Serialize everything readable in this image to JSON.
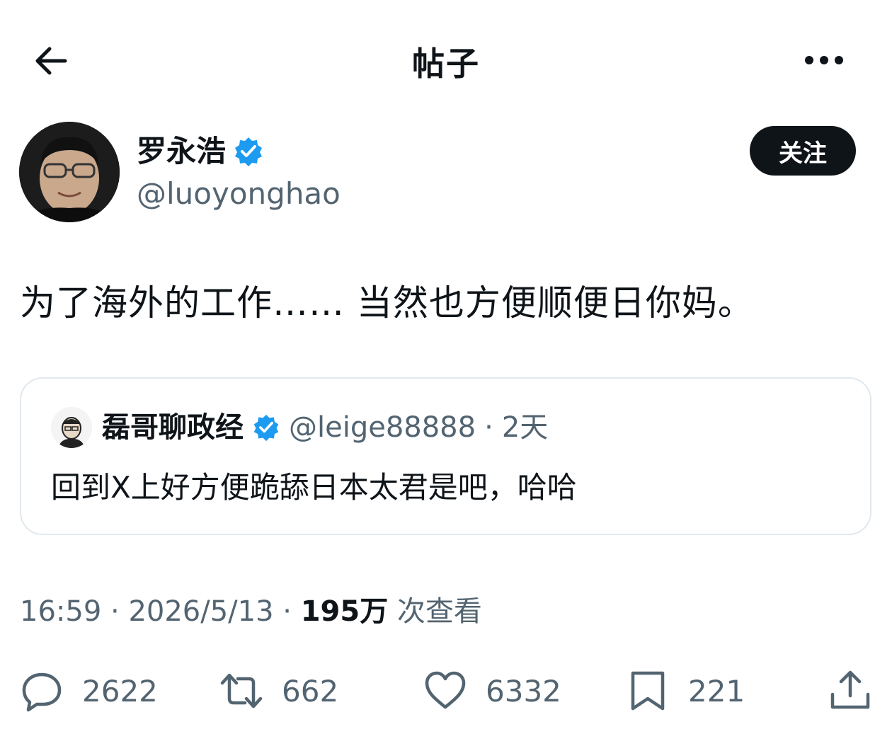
{
  "header": {
    "title": "帖子",
    "back_icon": "arrow-left-icon",
    "more_icon": "more-horizontal-icon"
  },
  "author": {
    "name": "罗永浩",
    "handle": "@luoyonghao",
    "verified_icon": "verified-badge-icon",
    "follow_label": "关注"
  },
  "post": {
    "text": "为了海外的工作…… 当然也方便顺便日你妈。"
  },
  "quote": {
    "name": "磊哥聊政经",
    "handle": "@leige88888",
    "separator": "·",
    "age": "2天",
    "text": "回到X上好方便跪舔日本太君是吧，哈哈"
  },
  "meta": {
    "time": "16:59",
    "separator": "·",
    "date": "2026/5/13",
    "views_count": "195万",
    "views_label": "次查看"
  },
  "actions": {
    "replies": "2622",
    "reposts": "662",
    "likes": "6332",
    "bookmarks": "221"
  },
  "colors": {
    "text": "#0f1419",
    "secondary": "#536471",
    "verified": "#1d9bf0",
    "border": "#e1e8ed"
  }
}
